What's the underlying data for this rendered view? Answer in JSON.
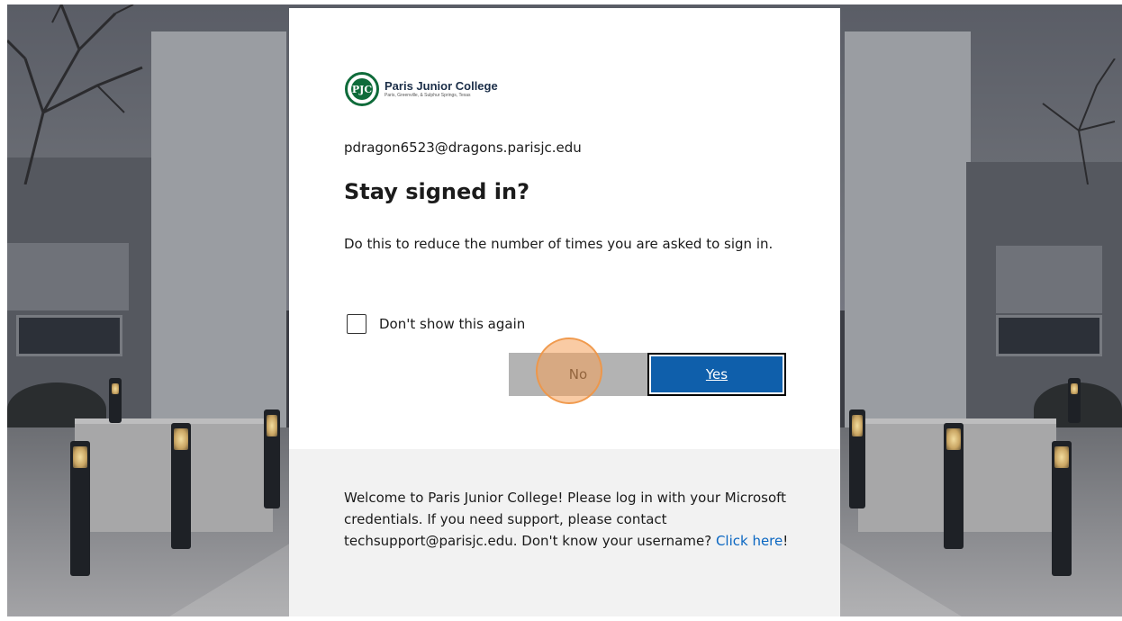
{
  "brand": {
    "name": "Paris Junior College",
    "tagline": "Paris, Greenville, & Sulphur Springs, Texas",
    "seal_text": "PJC",
    "color": "#0f6b3a"
  },
  "account": {
    "email": "pdragon6523@dragons.parisjc.edu"
  },
  "prompt": {
    "title": "Stay signed in?",
    "description": "Do this to reduce the number of times you are asked to sign in."
  },
  "checkbox": {
    "label": "Don't show this again",
    "checked": false
  },
  "buttons": {
    "no_label": "No",
    "yes_label": "Yes",
    "yes_color": "#0f5fab"
  },
  "footer": {
    "text_before_link": "Welcome to Paris Junior College! Please log in with your Microsoft credentials. If you need support, please contact techsupport@parisjc.edu. Don't know your username? ",
    "link_text": "Click here",
    "text_after_link": "!"
  },
  "icons": {
    "logo": "college-seal-icon"
  }
}
